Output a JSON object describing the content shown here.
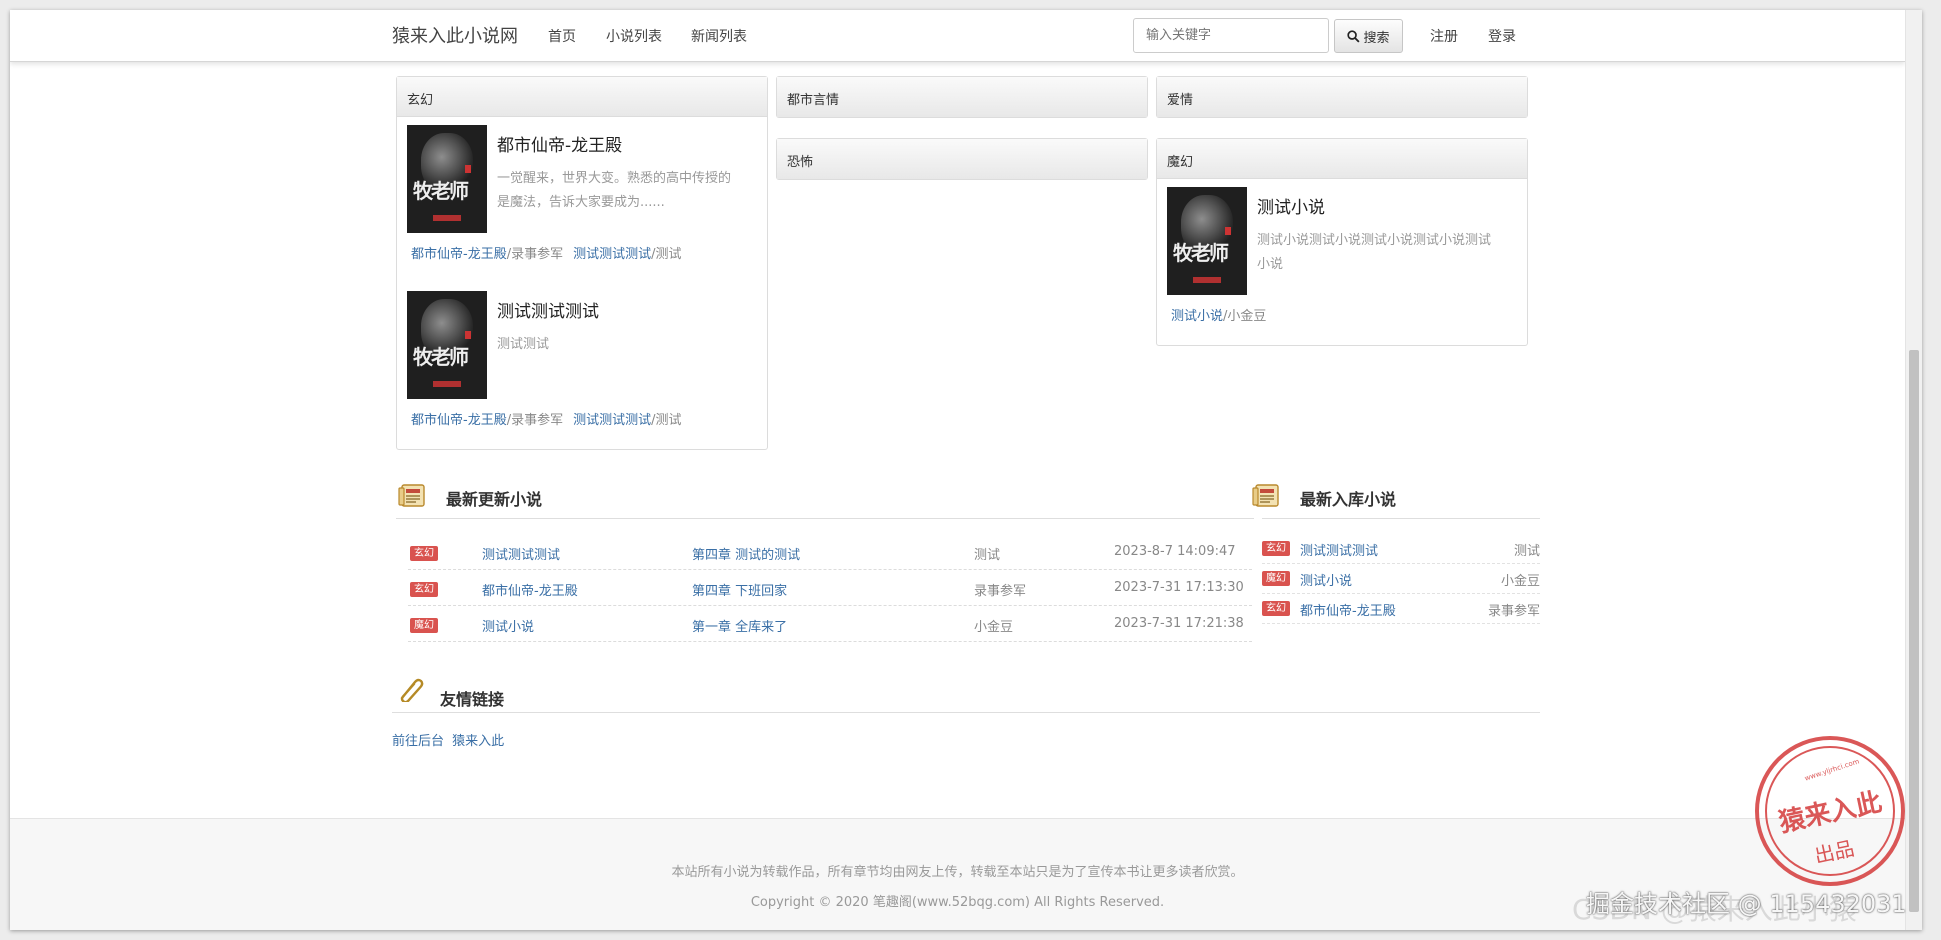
{
  "navbar": {
    "brand": "猿来入此小说网",
    "links": [
      "首页",
      "小说列表",
      "新闻列表"
    ],
    "search_placeholder": "输入关键字",
    "search_button": "搜索",
    "register": "注册",
    "login": "登录"
  },
  "categories": [
    {
      "name": "玄幻",
      "books": [
        {
          "title": "都市仙帝-龙王殿",
          "desc_lines": [
            "一觉醒来，世界大变。熟悉的高中传授的",
            "是魔法，告诉大家要成为......"
          ],
          "links": [
            {
              "book": "都市仙帝-龙王殿",
              "author": "/录事参军"
            },
            {
              "book": "测试测试测试",
              "author": "/测试"
            }
          ]
        },
        {
          "title": "测试测试测试",
          "desc_lines": [
            "测试测试"
          ],
          "links": [
            {
              "book": "都市仙帝-龙王殿",
              "author": "/录事参军"
            },
            {
              "book": "测试测试测试",
              "author": "/测试"
            }
          ]
        }
      ]
    },
    {
      "name": "都市言情",
      "books": []
    },
    {
      "name": "爱情",
      "books": []
    },
    {
      "name": "恐怖",
      "books": []
    },
    {
      "name": "魔幻",
      "books": [
        {
          "title": "测试小说",
          "desc_lines": [
            "测试小说测试小说测试小说测试小说测试",
            "小说"
          ],
          "links": [
            {
              "book": "测试小说",
              "author": "/小金豆"
            }
          ]
        }
      ]
    }
  ],
  "cover_text": "牧老师",
  "latest_updates": {
    "title": "最新更新小说",
    "rows": [
      {
        "tag": "玄幻",
        "book": "测试测试测试",
        "chapter": "第四章 测试的测试",
        "author": "测试",
        "time": "2023-8-7 14:09:47"
      },
      {
        "tag": "玄幻",
        "book": "都市仙帝-龙王殿",
        "chapter": "第四章 下班回家",
        "author": "录事参军",
        "time": "2023-7-31 17:13:30"
      },
      {
        "tag": "魔幻",
        "book": "测试小说",
        "chapter": "第一章 全库来了",
        "author": "小金豆",
        "time": "2023-7-31 17:21:38"
      }
    ]
  },
  "newest_books": {
    "title": "最新入库小说",
    "rows": [
      {
        "tag": "玄幻",
        "book": "测试测试测试",
        "author": "测试"
      },
      {
        "tag": "魔幻",
        "book": "测试小说",
        "author": "小金豆"
      },
      {
        "tag": "玄幻",
        "book": "都市仙帝-龙王殿",
        "author": "录事参军"
      }
    ]
  },
  "friend_links": {
    "title": "友情链接",
    "links": [
      "前往后台",
      "猿来入此"
    ]
  },
  "footer": {
    "line1": "本站所有小说为转载作品，所有章节均由网友上传，转载至本站只是为了宣传本书让更多读者欣赏。",
    "line2": "Copyright © 2020 笔趣阁(www.52bqg.com) All Rights Reserved."
  },
  "watermark": {
    "seal_main": "猿来入此",
    "seal_sub": "出品",
    "seal_url": "www.yljrhci.com",
    "caption": "掘金技术社区 @ 115432031",
    "caption_back": "CSDN @猿来入此小猿"
  },
  "colors": {
    "link": "#3a6fa6",
    "tag": "#d9534f",
    "seal": "#d43a3a"
  }
}
